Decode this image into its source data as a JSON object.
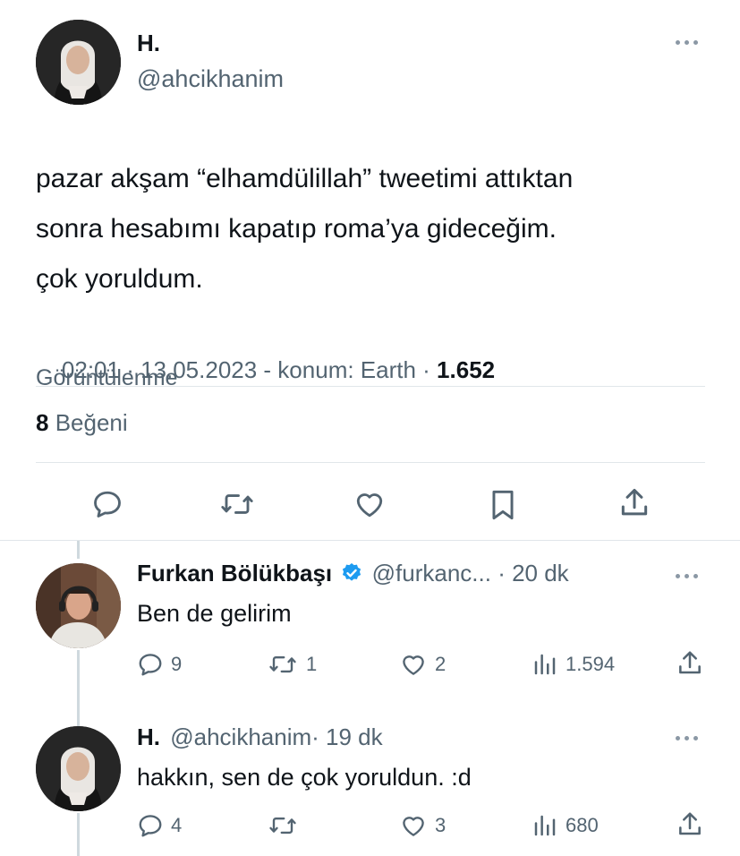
{
  "main_tweet": {
    "display_name": "H.",
    "handle": "@ahcikhanim",
    "text_lines": [
      "pazar akşam “elhamdülillah” tweetimi attıktan",
      "sonra hesabımı kapatıp roma’ya gideceğim.",
      "çok yoruldum."
    ],
    "meta": "02:01 · 13.05.2023 - konum: Earth · ",
    "views_count": "1.652",
    "views_label": "Görüntülenme",
    "likes_count": "8",
    "likes_label": "Beğeni"
  },
  "replies": [
    {
      "display_name": "Furkan Bölükbaşı",
      "handle": "@furkanc...",
      "time": "· 20 dk",
      "verified": true,
      "text": "Ben de gelirim",
      "reply_count": "9",
      "retweet_count": "1",
      "like_count": "2",
      "view_count": "1.594"
    },
    {
      "display_name": "H.",
      "handle": "@ahcikhanim",
      "time": "· 19 dk",
      "verified": false,
      "text": "hakkın, sen de çok yoruldun. :d",
      "reply_count": "4",
      "retweet_count": "",
      "like_count": "3",
      "view_count": "680"
    }
  ],
  "icons": [
    "more-icon",
    "reply-icon",
    "retweet-icon",
    "like-icon",
    "bookmark-icon",
    "share-icon",
    "views-icon",
    "verified-icon"
  ],
  "colors": {
    "text": "#0f1419",
    "muted": "#536471",
    "verified": "#1d9bf0",
    "divider": "#e1e6ea"
  }
}
